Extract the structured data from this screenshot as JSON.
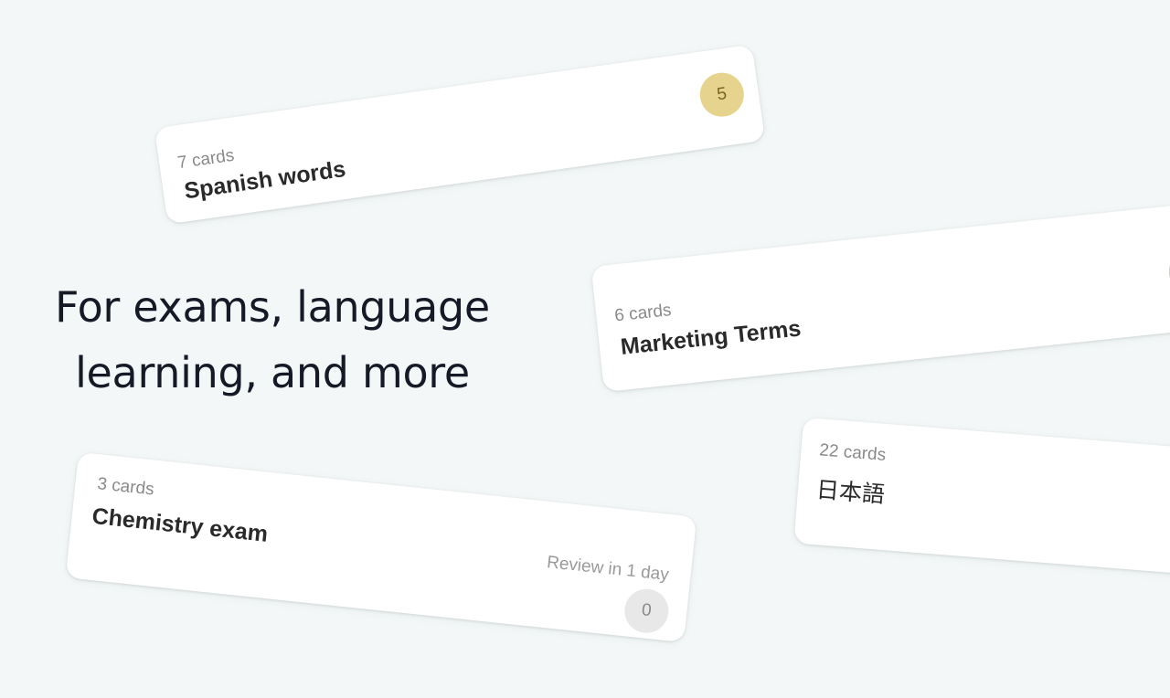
{
  "headline": {
    "line1": "For exams, language",
    "line2": "learning, and more"
  },
  "decks": [
    {
      "count": "7 cards",
      "title": "Spanish words",
      "badge": "5",
      "badge_color": "#e6d48e"
    },
    {
      "count": "6 cards",
      "title": "Marketing Terms",
      "badge_color": "#e6d48e"
    },
    {
      "count": "3 cards",
      "title": "Chemistry exam",
      "review": "Review in 1 day",
      "badge": "0",
      "badge_color": "#e8e8e8"
    },
    {
      "count": "22 cards",
      "title": "日本語"
    }
  ],
  "colors": {
    "background": "#f3f7f7",
    "card": "#ffffff",
    "headline": "#161a26"
  }
}
